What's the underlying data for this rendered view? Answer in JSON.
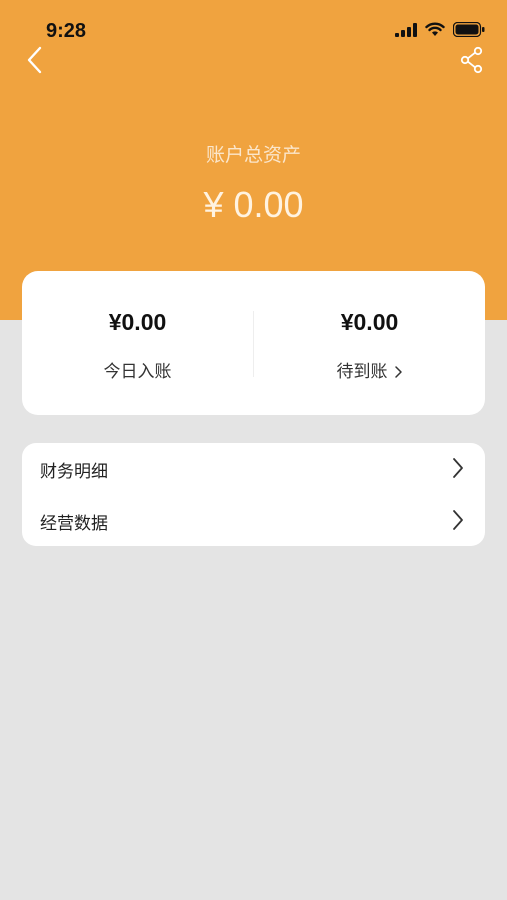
{
  "status_bar": {
    "time": "9:28"
  },
  "header": {
    "total_label": "账户总资产",
    "total_value": "¥ 0.00",
    "background_color": "#f0a33f"
  },
  "summary": {
    "today": {
      "amount": "¥0.00",
      "label": "今日入账"
    },
    "pending": {
      "amount": "¥0.00",
      "label": "待到账"
    }
  },
  "menu": [
    {
      "label": "财务明细",
      "icon": "chevron-right-icon"
    },
    {
      "label": "经营数据",
      "icon": "chevron-right-icon"
    }
  ],
  "icons": {
    "back": "chevron-left-icon",
    "share": "share-icon"
  }
}
